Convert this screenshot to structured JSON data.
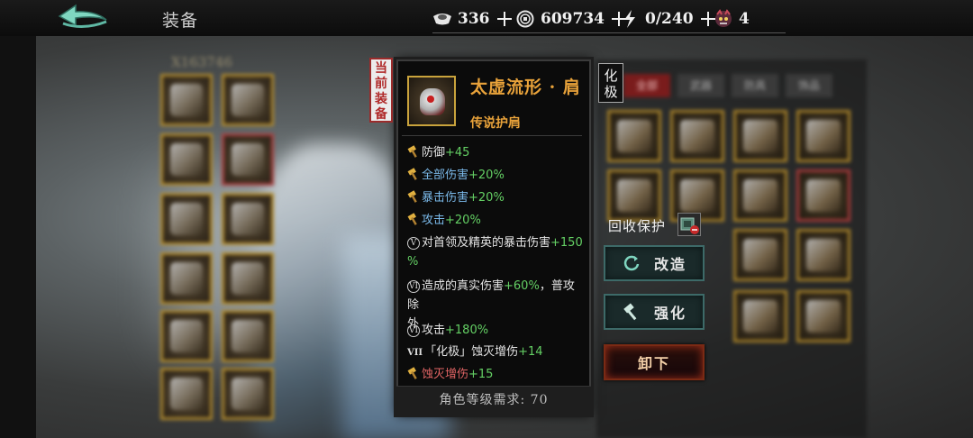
{
  "header": {
    "title": "装备",
    "resources": [
      {
        "icon": "ingot-icon",
        "value": "336"
      },
      {
        "icon": "coin-icon",
        "value": "609734"
      },
      {
        "icon": "lightning-icon",
        "value": "0/240"
      },
      {
        "icon": "demon-mask-icon",
        "value": "4"
      }
    ]
  },
  "background": {
    "character_id": "X163746",
    "inventory_tabs": [
      "全部",
      "武器",
      "防具",
      "饰品"
    ]
  },
  "tooltip": {
    "equipped_tag": [
      "当",
      "前",
      "装",
      "备"
    ],
    "item_name": "太虚流形 · 肩",
    "item_type": "传说护肩",
    "huaji_badge": [
      "化",
      "极"
    ],
    "stats": [
      {
        "prefix": "hammer",
        "label": "防御",
        "value": "+45",
        "label_color": "white"
      },
      {
        "prefix": "hammer",
        "label": "全部伤害",
        "value": "+20%",
        "label_color": "blue"
      },
      {
        "prefix": "hammer",
        "label": "暴击伤害",
        "value": "+20%",
        "label_color": "blue"
      },
      {
        "prefix": "hammer",
        "label": "攻击",
        "value": "+20%",
        "label_color": "blue"
      },
      {
        "prefix": "V",
        "label": "对首领及精英的暴击伤害",
        "value": "+150",
        "value2": "%",
        "label_color": "white"
      },
      {
        "prefix": "VI",
        "label": "造成的真实伤害",
        "value": "+60%",
        "suffix": "，普攻除",
        "suffix2": "外",
        "label_color": "white"
      },
      {
        "prefix": "VI",
        "label": "攻击",
        "value": "+180%",
        "label_color": "white"
      },
      {
        "prefix": "VII",
        "label": "「化极」蚀灭增伤",
        "value": "+14",
        "label_color": "white"
      },
      {
        "prefix": "hammer",
        "label": "蚀灭增伤",
        "value": "+15",
        "label_color": "red"
      }
    ],
    "level_requirement": "角色等级需求: 70"
  },
  "actions": {
    "recycle_protect_label": "回收保护",
    "reforge_label": "改造",
    "enhance_label": "强化",
    "unequip_label": "卸下"
  },
  "colors": {
    "legendary": "#e8a23a",
    "stat_green": "#64d064",
    "stat_blue": "#7ab8e8",
    "stat_red": "#e06464"
  }
}
